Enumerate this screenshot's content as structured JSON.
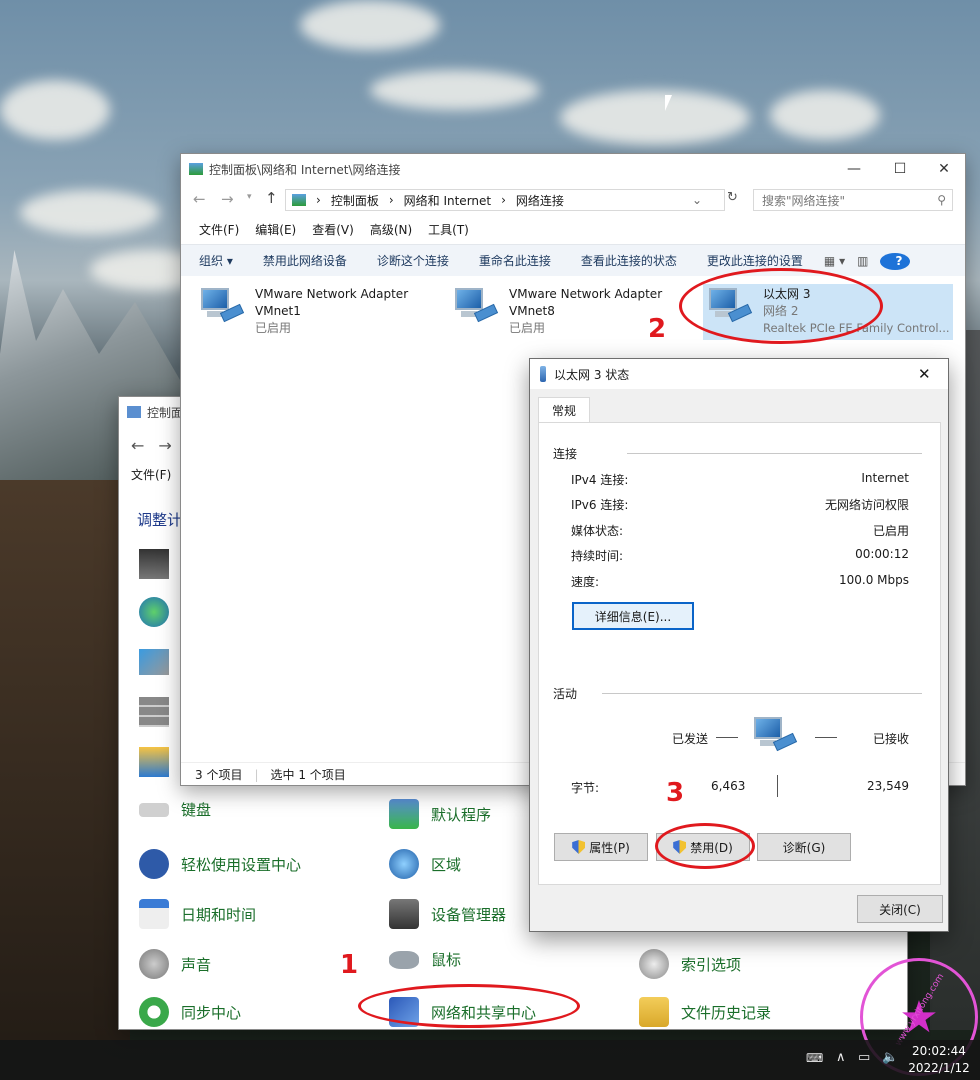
{
  "network_window": {
    "title": "控制面板\\网络和 Internet\\网络连接",
    "breadcrumb": [
      "控制面板",
      "网络和 Internet",
      "网络连接"
    ],
    "search_placeholder": "搜索\"网络连接\"",
    "menu": [
      "文件(F)",
      "编辑(E)",
      "查看(V)",
      "高级(N)",
      "工具(T)"
    ],
    "commands": [
      "组织 ▾",
      "禁用此网络设备",
      "诊断这个连接",
      "重命名此连接",
      "查看此连接的状态",
      "更改此连接的设置"
    ],
    "adapters": [
      {
        "line1": "VMware Network Adapter",
        "line2": "VMnet1",
        "line3": "已启用"
      },
      {
        "line1": "VMware Network Adapter",
        "line2": "VMnet8",
        "line3": "已启用"
      },
      {
        "line1": "以太网 3",
        "line2": "网络 2",
        "line3": "Realtek PCIe FE Family Control..."
      }
    ],
    "status_items": "3 个项目",
    "status_selected": "选中 1 个项目"
  },
  "status_dialog": {
    "title": "以太网 3 状态",
    "tab": "常规",
    "section_connection": "连接",
    "connection_rows": [
      {
        "label": "IPv4 连接:",
        "value": "Internet"
      },
      {
        "label": "IPv6 连接:",
        "value": "无网络访问权限"
      },
      {
        "label": "媒体状态:",
        "value": "已启用"
      },
      {
        "label": "持续时间:",
        "value": "00:00:12"
      },
      {
        "label": "速度:",
        "value": "100.0 Mbps"
      }
    ],
    "details_button": "详细信息(E)...",
    "section_activity": "活动",
    "sent_label": "已发送",
    "received_label": "已接收",
    "bytes_label": "字节:",
    "bytes_sent": "6,463",
    "bytes_received": "23,549",
    "properties_button": "属性(P)",
    "disable_button": "禁用(D)",
    "diagnose_button": "诊断(G)",
    "close_button": "关闭(C)"
  },
  "control_panel": {
    "title": "控制面",
    "menu_file": "文件(F)",
    "heading": "调整计",
    "items": [
      "键盘",
      "默认程序",
      "轻松使用设置中心",
      "区域",
      "日期和时间",
      "设备管理器",
      "声音",
      "鼠标",
      "索引选项",
      "同步中心",
      "网络和共享中心",
      "文件历史记录"
    ]
  },
  "annotations": [
    "1",
    "2",
    "3"
  ],
  "taskbar": {
    "time": "20:02:44",
    "date": "2022/1/12"
  },
  "watermark": "www.yrxitong.com",
  "colors": {
    "annotation_red": "#e0191e",
    "link_green": "#1a6e2a",
    "accent_blue": "#1e3a5f"
  }
}
